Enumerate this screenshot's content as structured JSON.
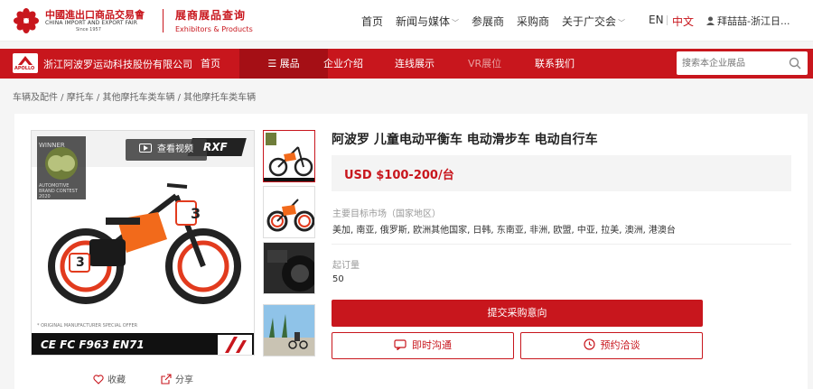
{
  "header": {
    "logo_cn": "中國進出口商品交易會",
    "logo_en": "CHINA IMPORT AND EXPORT FAIR",
    "logo_since": "Since 1957",
    "subtitle_cn": "展商展品查询",
    "subtitle_en": "Exhibitors & Products",
    "nav": [
      {
        "label": "首页",
        "dropdown": false
      },
      {
        "label": "新闻与媒体",
        "dropdown": true
      },
      {
        "label": "参展商",
        "dropdown": false
      },
      {
        "label": "采购商",
        "dropdown": false
      },
      {
        "label": "关于广交会",
        "dropdown": true
      }
    ],
    "lang_en": "EN",
    "lang_zh": "中文",
    "user": "拜喆喆-浙江日..."
  },
  "company_bar": {
    "logo_text": "APOLLO",
    "name": "浙江阿波罗运动科技股份有限公司",
    "nav": [
      {
        "label": "首页",
        "active": false,
        "muted": false
      },
      {
        "label": "展品",
        "active": true,
        "muted": false
      },
      {
        "label": "企业介绍",
        "active": false,
        "muted": false
      },
      {
        "label": "连线展示",
        "active": false,
        "muted": false
      },
      {
        "label": "VR展位",
        "active": false,
        "muted": true
      },
      {
        "label": "联系我们",
        "active": false,
        "muted": false
      }
    ],
    "search_placeholder": "搜索本企业展品"
  },
  "breadcrumb": "车辆及配件 / 摩托车 / 其他摩托车类车辆 / 其他摩托车类车辆",
  "gallery": {
    "video_label": "查看视频",
    "badge_top": "WINNER",
    "badge_bottom": "AUTOMOTIVE BRAND CONTEST 2020",
    "brand_mark": "RXF",
    "disclaimer": "* ORIGINAL MANUFACTURER SPECIAL OFFER",
    "cert": "CE FC F963 EN71",
    "plate_number": "3",
    "thumb_count": 4
  },
  "product": {
    "title": "阿波罗 儿童电动平衡车 电动滑步车 电动自行车",
    "price": "USD $100-200/台",
    "market_label": "主要目标市场（国家地区）",
    "market_value": "美加, 南亚, 俄罗斯, 欧洲其他国家, 日韩, 东南亚, 非洲, 欧盟, 中亚, 拉美, 澳洲, 港澳台",
    "moq_label": "起订量",
    "moq_value": "50",
    "btn_inquiry": "提交采购意向",
    "btn_chat": "即时沟通",
    "btn_meet": "预约洽谈",
    "fav": "收藏",
    "share": "分享"
  },
  "colors": {
    "brand_red": "#c8161d",
    "price_bg": "#f4f4f4"
  }
}
